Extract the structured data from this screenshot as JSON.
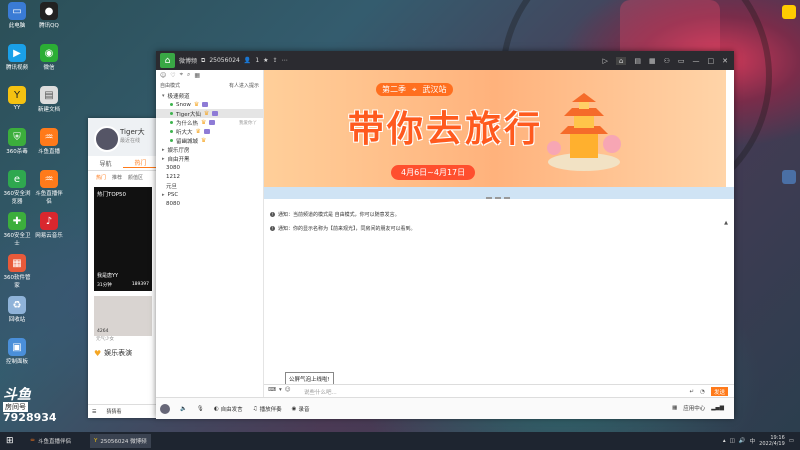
{
  "desktop_icons": [
    {
      "label": "此电脑",
      "color": "#3a7bd5"
    },
    {
      "label": "腾讯QQ",
      "color": "#222222"
    },
    {
      "label": "腾讯视频",
      "color": "#1aa0e8"
    },
    {
      "label": "微信",
      "color": "#2bae35"
    },
    {
      "label": "YY",
      "color": "#f5c211"
    },
    {
      "label": "新建文档",
      "color": "#dddddd"
    },
    {
      "label": "360杀毒",
      "color": "#3cae3c"
    },
    {
      "label": "斗鱼直播",
      "color": "#ff7a1a"
    },
    {
      "label": "360安全浏览器",
      "color": "#2fa84f"
    },
    {
      "label": "斗鱼直播伴侣",
      "color": "#ff7a1a"
    },
    {
      "label": "360安全卫士",
      "color": "#3cae3c"
    },
    {
      "label": "网易云音乐",
      "color": "#d9272e"
    },
    {
      "label": "360软件管家",
      "color": "#e85a3a"
    },
    {
      "label": "回收站",
      "color": "#8fb3d9"
    },
    {
      "label": "控制面板",
      "color": "#4a8fd9"
    }
  ],
  "left_panel": {
    "username": "Tiger大",
    "sub": "最近在线",
    "tabs": [
      "导航",
      "热门"
    ],
    "active_tab": "热门",
    "sub_tabs": [
      "热门",
      "推荐",
      "颜值区"
    ],
    "card1": {
      "title": "热门TOP50",
      "name": "我是唐YY",
      "stat_left": "31分钟",
      "stat_right": "189397"
    },
    "card2": {
      "count": "4264",
      "caption": "元气少女"
    },
    "section": "娱乐表演",
    "bottom_labels": [
      "应用",
      "猜猜看"
    ]
  },
  "window": {
    "room_name": "微博频",
    "channel_id": "25056024",
    "user_count": "1",
    "controls": [
      "—",
      "□",
      "✕"
    ],
    "sidebar": {
      "mode": "自由模式",
      "enter_hint": "有人进入提示",
      "channel_label": "极速频道",
      "members": [
        {
          "name": "Snow"
        },
        {
          "name": "Tiger大仙",
          "selected": true
        },
        {
          "name": "为什么热",
          "suffix": "我爱你丫"
        },
        {
          "name": "听大大"
        },
        {
          "name": "留幽城城"
        }
      ],
      "sub_channels": [
        "娱乐厅房",
        "自由开黑",
        "3080",
        "1212",
        "元旦",
        "PSC",
        "8080"
      ]
    },
    "banner": {
      "season": "第二季",
      "city": "武汉站",
      "title": "带你去旅行",
      "dates": "4月6日~4月17日"
    },
    "notices": [
      "通知：当前频道的模式是 自由模式，你可以随意发言。",
      "通知：你的显示名称为【前来观光】，同房间的朋友可以看到。"
    ],
    "tooltip": "公屏气泡上线啦!",
    "input_placeholder": "说些什么吧...",
    "send_label": "发送",
    "bottom": {
      "items": [
        "自由发言",
        "播放伴奏",
        "录音"
      ],
      "right": "应用中心"
    }
  },
  "taskbar": {
    "apps": [
      {
        "label": "斗鱼直播伴侣"
      },
      {
        "label": "25056024 微博频"
      }
    ],
    "time": "19:16",
    "date": "2022/4/19"
  },
  "watermark": {
    "logo": "斗鱼",
    "room_label": "房间号",
    "room_number": "7928934"
  }
}
